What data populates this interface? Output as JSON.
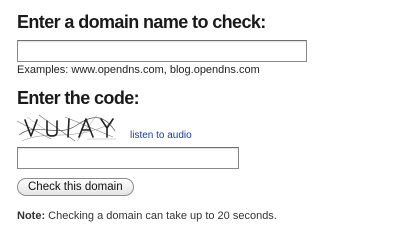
{
  "domain_section": {
    "heading": "Enter a domain name to check:",
    "input_value": "",
    "examples": "Examples: www.opendns.com, blog.opendns.com"
  },
  "code_section": {
    "heading": "Enter the code:",
    "captcha_text": "VUIAY",
    "audio_link": "listen to audio",
    "input_value": ""
  },
  "actions": {
    "check_button": "Check this domain"
  },
  "note": {
    "label": "Note:",
    "text": " Checking a domain can take up to 20 seconds."
  },
  "colors": {
    "link": "#1a3d8f",
    "heading": "#1a1a1a",
    "input_border": "#8a8a8a"
  }
}
